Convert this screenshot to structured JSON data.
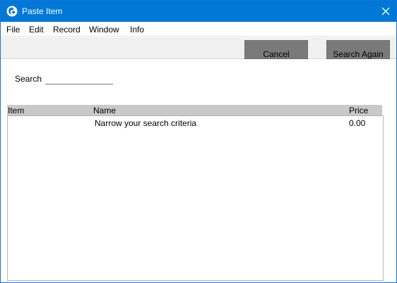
{
  "window": {
    "title": "Paste Item",
    "title_bar_color": "#0078d7"
  },
  "icons": {
    "app": "app-logo-icon",
    "close": "close-icon"
  },
  "menu": {
    "items": [
      {
        "label": "File"
      },
      {
        "label": "Edit"
      },
      {
        "label": "Record"
      },
      {
        "label": "Window"
      },
      {
        "label": "Info"
      }
    ]
  },
  "toolbar": {
    "cancel_label": "Cancel",
    "search_again_label": "Search Again"
  },
  "search": {
    "label": "Search",
    "value": ""
  },
  "table": {
    "columns": [
      {
        "label": "Item"
      },
      {
        "label": "Name"
      },
      {
        "label": "Price"
      }
    ],
    "rows": [
      {
        "item": "",
        "name": "Narrow your search criteria",
        "price": "0.00"
      }
    ]
  }
}
